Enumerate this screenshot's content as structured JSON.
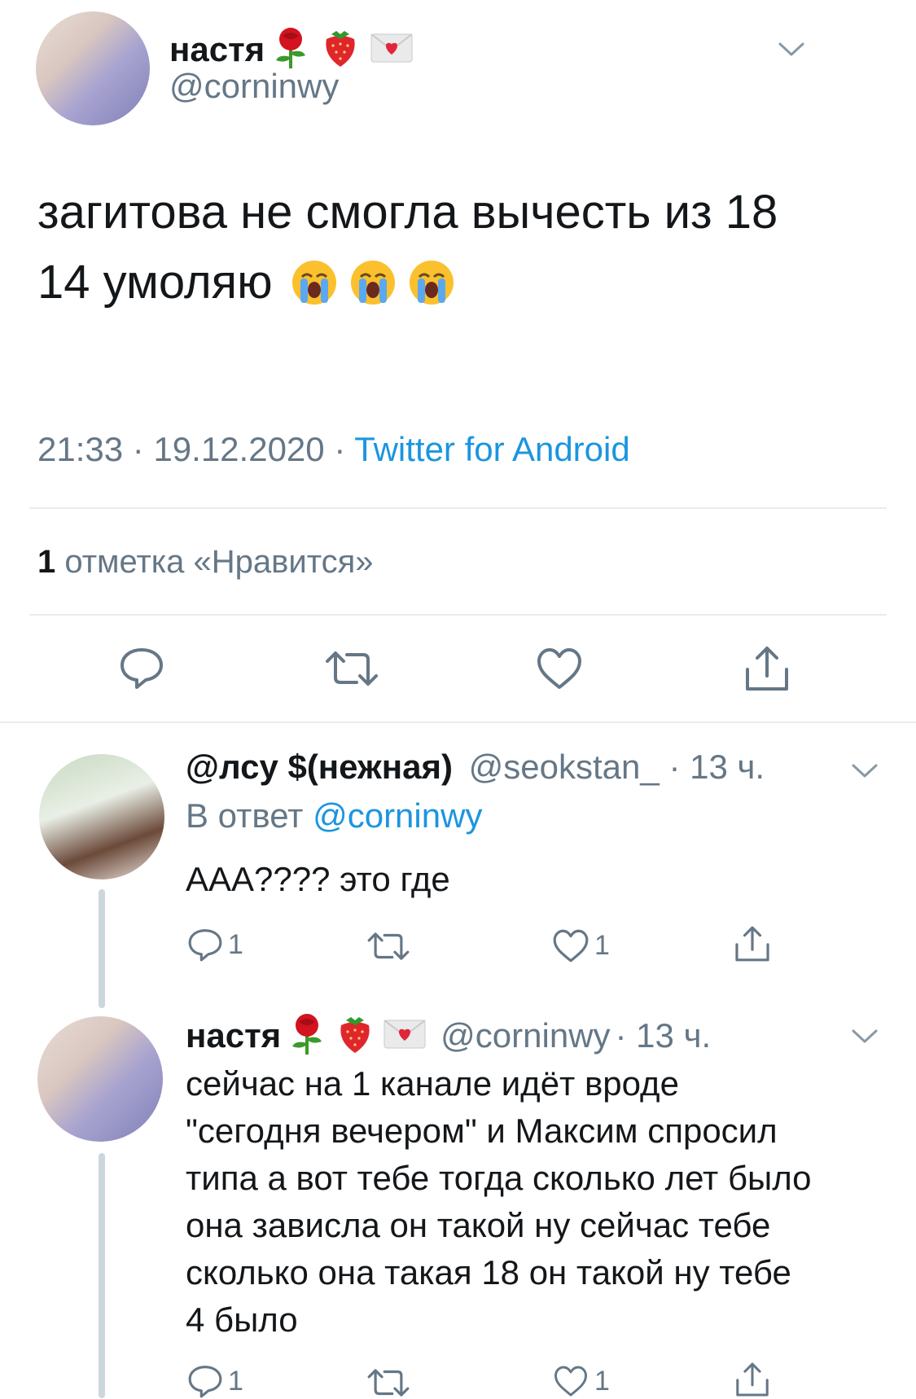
{
  "tweet": {
    "author": {
      "name": "настя",
      "handle": "@corninwy"
    },
    "text": [
      "загитова не смогла вычесть из 18",
      "14 умоляю"
    ],
    "meta": {
      "time": "21:33",
      "sep": " · ",
      "date": "19.12.2020",
      "sep2": " · ",
      "source": "Twitter for Android"
    },
    "likes": {
      "count": "1",
      "label": " отметка «Нравится»"
    }
  },
  "replies": [
    {
      "name": "@лсу $(нежная)",
      "handle": "@seokstan_",
      "time": "· 13 ч.",
      "reply_to_prefix": "В ответ ",
      "reply_to": "@corninwy",
      "text": "ААА???? это где",
      "reply_count": "1",
      "like_count": "1"
    },
    {
      "name": "настя",
      "handle": "@corninwy",
      "time": "· 13 ч.",
      "text_lines": [
        "сейчас на 1 канале идёт вроде",
        "\"сегодня вечером\" и Максим спросил",
        "типа а вот тебе тогда сколько лет было",
        "она зависла он такой ну сейчас тебе",
        "сколько она такая 18 он такой ну тебе",
        "4 было"
      ],
      "reply_count": "1",
      "like_count": "1"
    }
  ],
  "colors": {
    "link": "#1b95e0",
    "gray": "#657786",
    "divider": "#e6ecf0"
  }
}
